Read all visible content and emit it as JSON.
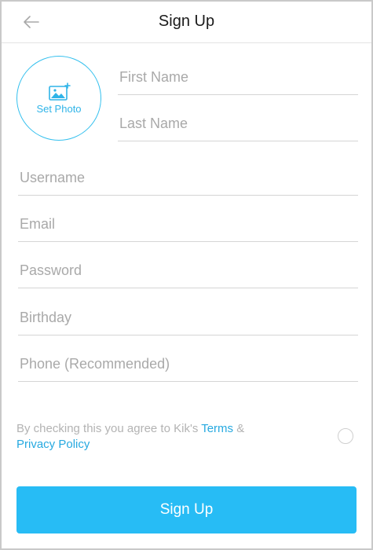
{
  "header": {
    "title": "Sign Up",
    "back_icon": "arrow-left-icon"
  },
  "photo": {
    "label": "Set Photo",
    "icon": "add-image-icon"
  },
  "fields": {
    "first_name": {
      "placeholder": "First Name",
      "value": ""
    },
    "last_name": {
      "placeholder": "Last Name",
      "value": ""
    },
    "username": {
      "placeholder": "Username",
      "value": ""
    },
    "email": {
      "placeholder": "Email",
      "value": ""
    },
    "password": {
      "placeholder": "Password",
      "value": ""
    },
    "birthday": {
      "placeholder": "Birthday",
      "value": ""
    },
    "phone": {
      "placeholder": "Phone (Recommended)",
      "value": ""
    }
  },
  "terms": {
    "prefix": "By checking this you agree to Kik's ",
    "terms_link": "Terms",
    "connector": " & ",
    "privacy_link": "Privacy Policy",
    "checked": false
  },
  "submit": {
    "label": "Sign Up"
  },
  "colors": {
    "accent": "#27bcf5",
    "link": "#26a9e0",
    "placeholder": "#a9a9a9",
    "divider": "#d5d5d5"
  }
}
